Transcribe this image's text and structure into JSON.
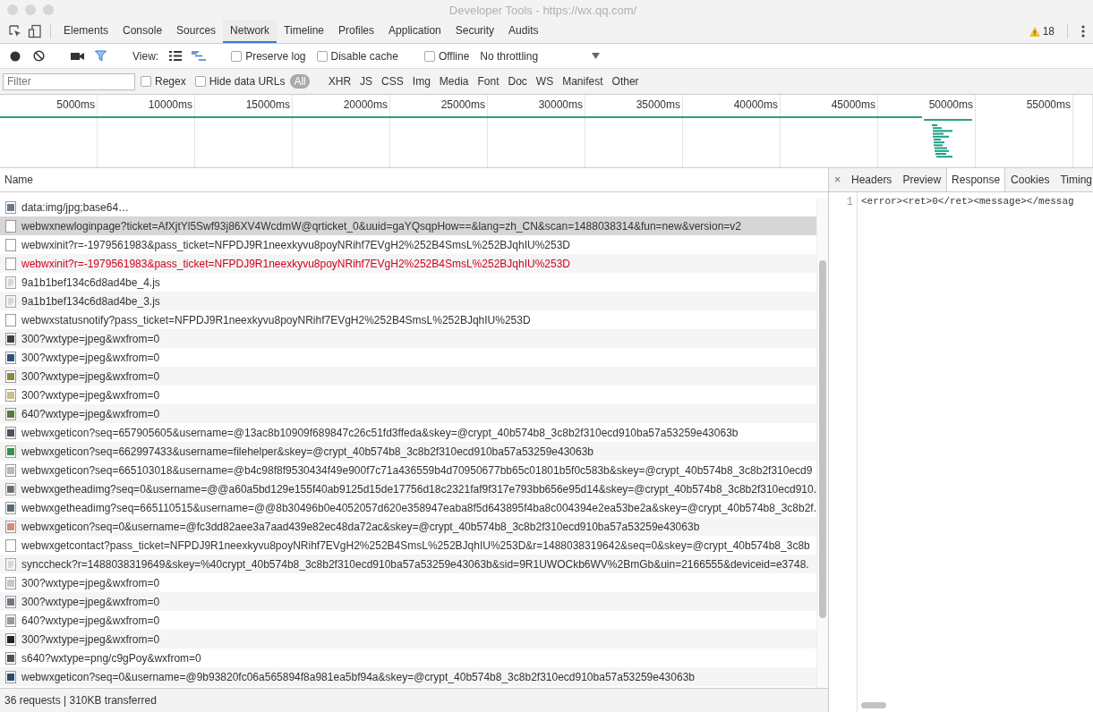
{
  "window": {
    "title": "Developer Tools - https://wx.qq.com/"
  },
  "panel_tabs": [
    {
      "label": "Elements",
      "selected": false
    },
    {
      "label": "Console",
      "selected": false
    },
    {
      "label": "Sources",
      "selected": false
    },
    {
      "label": "Network",
      "selected": true
    },
    {
      "label": "Timeline",
      "selected": false
    },
    {
      "label": "Profiles",
      "selected": false
    },
    {
      "label": "Application",
      "selected": false
    },
    {
      "label": "Security",
      "selected": false
    },
    {
      "label": "Audits",
      "selected": false
    }
  ],
  "warnings": {
    "count": "18"
  },
  "toolbar": {
    "recording": true,
    "view_label": "View:",
    "preserve_log": {
      "label": "Preserve log",
      "checked": false
    },
    "disable_cache": {
      "label": "Disable cache",
      "checked": false
    },
    "offline": {
      "label": "Offline",
      "checked": false
    },
    "throttling": "No throttling"
  },
  "filter_bar": {
    "placeholder": "Filter",
    "regex": {
      "label": "Regex",
      "checked": false
    },
    "hide_data_urls": {
      "label": "Hide data URLs",
      "checked": false
    },
    "types": [
      {
        "label": "All",
        "selected": true
      },
      {
        "label": "XHR",
        "selected": false
      },
      {
        "label": "JS",
        "selected": false
      },
      {
        "label": "CSS",
        "selected": false
      },
      {
        "label": "Img",
        "selected": false
      },
      {
        "label": "Media",
        "selected": false
      },
      {
        "label": "Font",
        "selected": false
      },
      {
        "label": "Doc",
        "selected": false
      },
      {
        "label": "WS",
        "selected": false
      },
      {
        "label": "Manifest",
        "selected": false
      },
      {
        "label": "Other",
        "selected": false
      }
    ]
  },
  "overview": {
    "ticks": [
      "5000ms",
      "10000ms",
      "15000ms",
      "20000ms",
      "25000ms",
      "30000ms",
      "35000ms",
      "40000ms",
      "45000ms",
      "50000ms",
      "55000ms"
    ]
  },
  "requests": {
    "column": "Name",
    "rows": [
      {
        "name": "data:img/jpg;base64…",
        "kind": "image",
        "color": "#6a7a8a",
        "selected": false,
        "failed": false
      },
      {
        "name": "webwxnewloginpage?ticket=AfXjtYl5Swf93j86XV4WcdmW@qrticket_0&uuid=gaYQsqpHow==&lang=zh_CN&scan=1488038314&fun=new&version=v2",
        "kind": "doc",
        "selected": true,
        "failed": false
      },
      {
        "name": "webwxinit?r=-1979561983&pass_ticket=NFPDJ9R1neexkyvu8poyNRihf7EVgH2%252B4SmsL%252BJqhIU%253D",
        "kind": "doc",
        "selected": false,
        "failed": false
      },
      {
        "name": "webwxinit?r=-1979561983&pass_ticket=NFPDJ9R1neexkyvu8poyNRihf7EVgH2%252B4SmsL%252BJqhIU%253D",
        "kind": "doc",
        "selected": false,
        "failed": true
      },
      {
        "name": "9a1b1bef134c6d8ad4be_4.js",
        "kind": "script",
        "selected": false,
        "failed": false
      },
      {
        "name": "9a1b1bef134c6d8ad4be_3.js",
        "kind": "script",
        "selected": false,
        "failed": false
      },
      {
        "name": "webwxstatusnotify?pass_ticket=NFPDJ9R1neexkyvu8poyNRihf7EVgH2%252B4SmsL%252BJqhIU%253D",
        "kind": "doc",
        "selected": false,
        "failed": false
      },
      {
        "name": "300?wxtype=jpeg&wxfrom=0",
        "kind": "image",
        "color": "#3a3f48",
        "selected": false,
        "failed": false
      },
      {
        "name": "300?wxtype=jpeg&wxfrom=0",
        "kind": "image",
        "color": "#2f4f7f",
        "selected": false,
        "failed": false
      },
      {
        "name": "300?wxtype=jpeg&wxfrom=0",
        "kind": "image",
        "color": "#8a8a3a",
        "selected": false,
        "failed": false
      },
      {
        "name": "300?wxtype=jpeg&wxfrom=0",
        "kind": "image",
        "color": "#c8c08a",
        "selected": false,
        "failed": false
      },
      {
        "name": "640?wxtype=jpeg&wxfrom=0",
        "kind": "image",
        "color": "#5a7a3a",
        "selected": false,
        "failed": false
      },
      {
        "name": "webwxgeticon?seq=657905605&username=@13ac8b10909f689847c26c51fd3ffeda&skey=@crypt_40b574b8_3c8b2f310ecd910ba57a53259e43063b",
        "kind": "image",
        "color": "#4a5560",
        "selected": false,
        "failed": false
      },
      {
        "name": "webwxgeticon?seq=662997433&username=filehelper&skey=@crypt_40b574b8_3c8b2f310ecd910ba57a53259e43063b",
        "kind": "image",
        "color": "#3e8e4e",
        "selected": false,
        "failed": false
      },
      {
        "name": "webwxgeticon?seq=665103018&username=@b4c98f8f9530434f49e900f7c71a436559b4d70950677bb65c01801b5f0c583b&skey=@crypt_40b574b8_3c8b2f310ecd9",
        "kind": "image",
        "color": "#b8b8b8",
        "selected": false,
        "failed": false
      },
      {
        "name": "webwxgetheadimg?seq=0&username=@@a60a5bd129e155f40ab9125d15de17756d18c2321faf9f317e793bb656e95d14&skey=@crypt_40b574b8_3c8b2f310ecd910.",
        "kind": "image",
        "color": "#6a6a6a",
        "selected": false,
        "failed": false
      },
      {
        "name": "webwxgetheadimg?seq=665110515&username=@@8b30496b0e4052057d620e358947eaba8f5d643895f4ba8c004394e2ea53be2a&skey=@crypt_40b574b8_3c8b2f.",
        "kind": "image",
        "color": "#5a6a70",
        "selected": false,
        "failed": false
      },
      {
        "name": "webwxgeticon?seq=0&username=@fc3dd82aee3a7aad439e82ec48da72ac&skey=@crypt_40b574b8_3c8b2f310ecd910ba57a53259e43063b",
        "kind": "image",
        "color": "#d88a7a",
        "selected": false,
        "failed": false
      },
      {
        "name": "webwxgetcontact?pass_ticket=NFPDJ9R1neexkyvu8poyNRihf7EVgH2%252B4SmsL%252BJqhIU%253D&r=1488038319642&seq=0&skey=@crypt_40b574b8_3c8b",
        "kind": "doc",
        "selected": false,
        "failed": false
      },
      {
        "name": "synccheck?r=1488038319649&skey=%40crypt_40b574b8_3c8b2f310ecd910ba57a53259e43063b&sid=9R1UWOCkb6WV%2BmGb&uin=2166555&deviceid=e3748.",
        "kind": "script",
        "selected": false,
        "failed": false
      },
      {
        "name": "300?wxtype=jpeg&wxfrom=0",
        "kind": "image",
        "color": "#c8c8c8",
        "selected": false,
        "failed": false
      },
      {
        "name": "300?wxtype=jpeg&wxfrom=0",
        "kind": "image",
        "color": "#707880",
        "selected": false,
        "failed": false
      },
      {
        "name": "640?wxtype=jpeg&wxfrom=0",
        "kind": "image",
        "color": "#9a9a9a",
        "selected": false,
        "failed": false
      },
      {
        "name": "300?wxtype=jpeg&wxfrom=0",
        "kind": "image",
        "color": "#222222",
        "selected": false,
        "failed": false
      },
      {
        "name": "s640?wxtype=png/c9gPoy&wxfrom=0",
        "kind": "image",
        "color": "#505050",
        "selected": false,
        "failed": false
      },
      {
        "name": "webwxgeticon?seq=0&username=@9b93820fc06a565894f8a981ea5bf94a&skey=@crypt_40b574b8_3c8b2f310ecd910ba57a53259e43063b",
        "kind": "image",
        "color": "#2a4a6a",
        "selected": false,
        "failed": false
      }
    ]
  },
  "status_bar": "36 requests | 310KB transferred",
  "detail": {
    "tabs": [
      {
        "label": "Headers",
        "selected": false
      },
      {
        "label": "Preview",
        "selected": false
      },
      {
        "label": "Response",
        "selected": true
      },
      {
        "label": "Cookies",
        "selected": false
      },
      {
        "label": "Timing",
        "selected": false
      }
    ],
    "close": "×",
    "lines": [
      {
        "number": "1",
        "code": "<error><ret>0</ret><message></messag"
      }
    ]
  }
}
